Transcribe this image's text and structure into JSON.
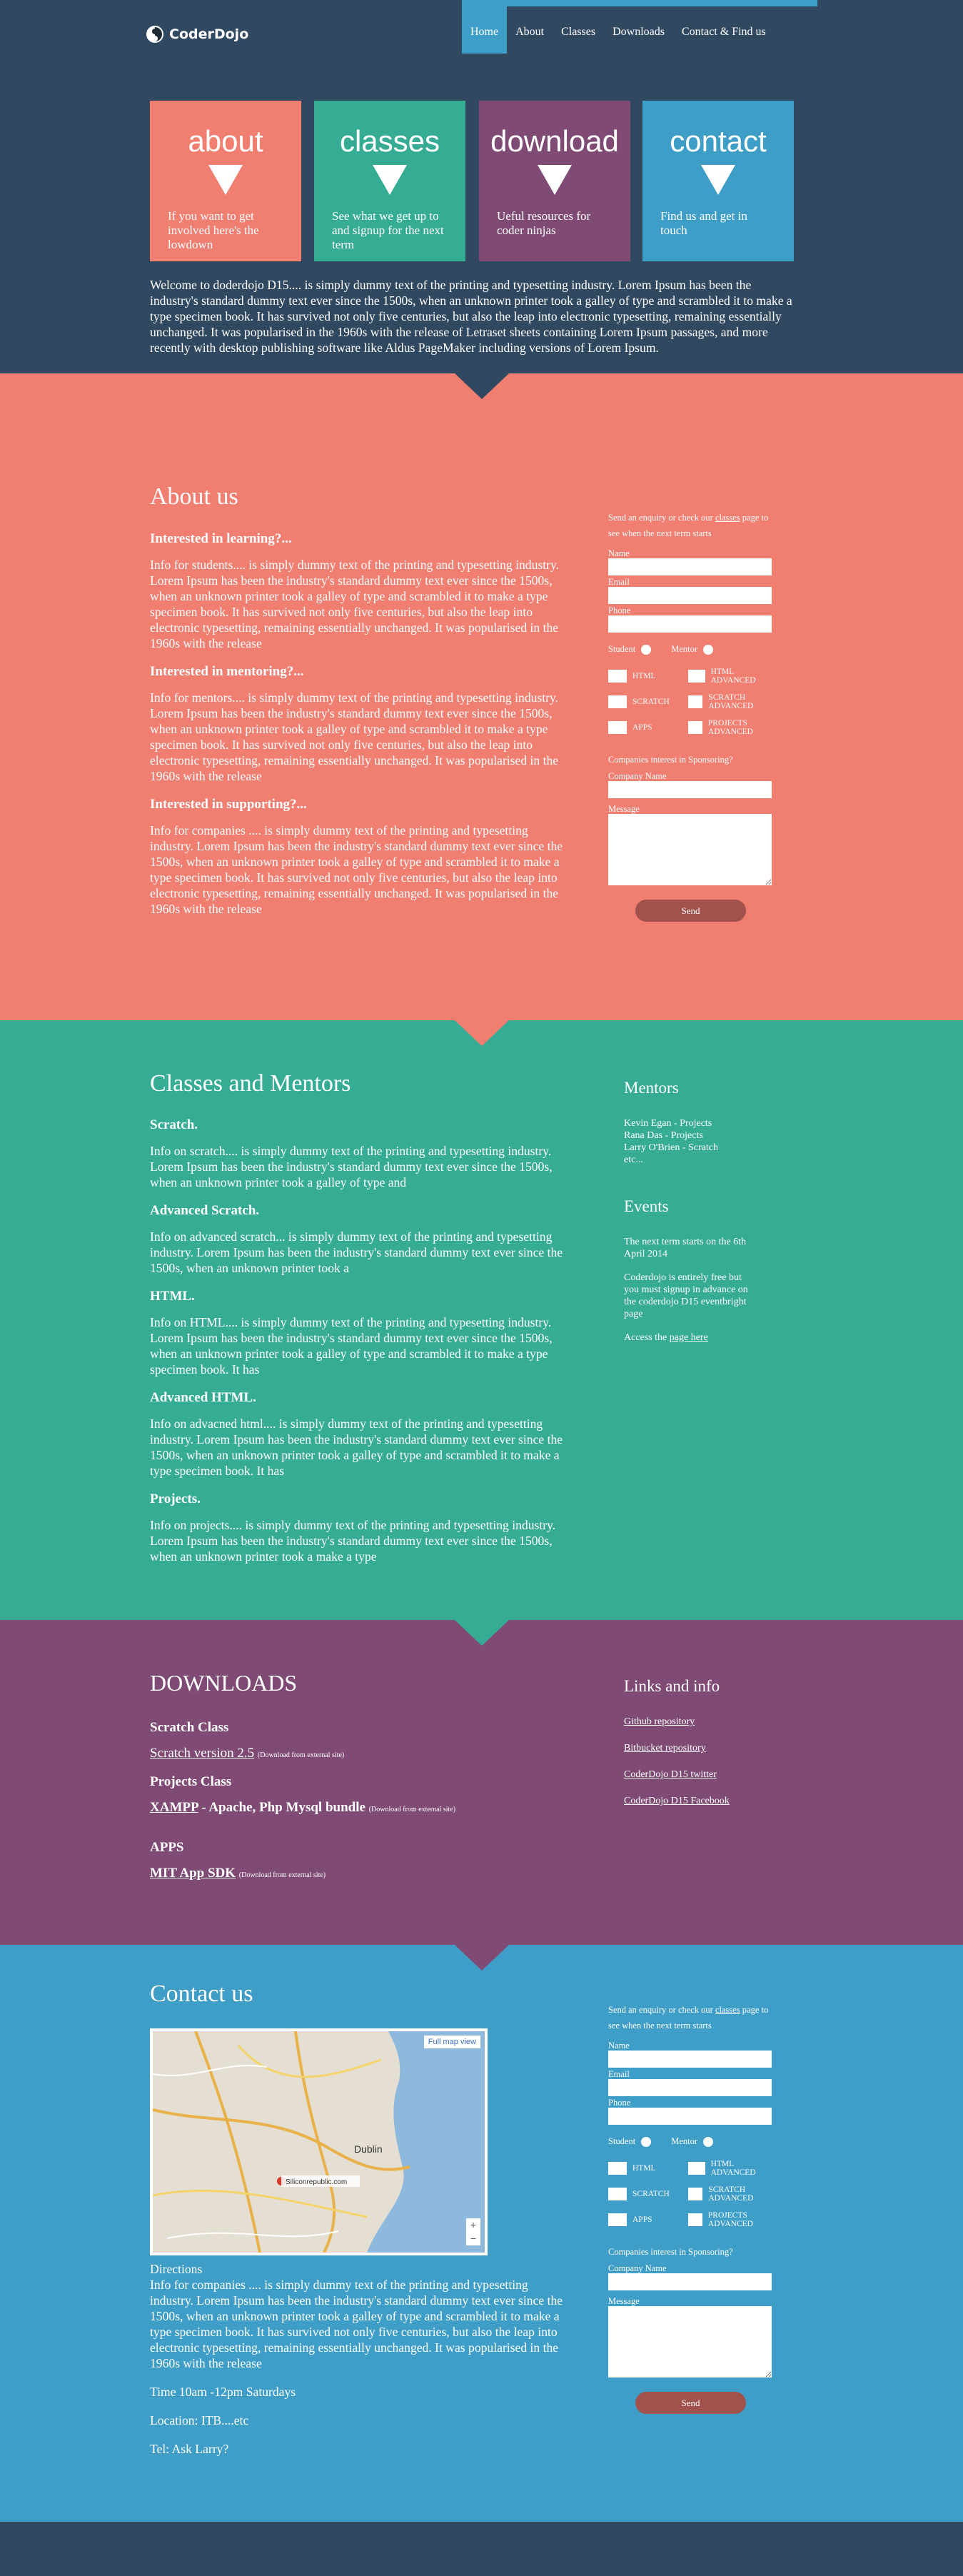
{
  "brand": {
    "name": "CoderDojo"
  },
  "nav": [
    "Home",
    "About",
    "Classes",
    "Downloads",
    "Contact & Find us"
  ],
  "tiles": [
    {
      "title": "about",
      "desc": "If you want to get involved here's the lowdown",
      "color": "#f07e71"
    },
    {
      "title": "classes",
      "desc": "See what we get up to and signup for the next term",
      "color": "#37ac94"
    },
    {
      "title": "download",
      "desc": "Ueful resources for coder ninjas",
      "color": "#7f4b74"
    },
    {
      "title": "contact",
      "desc": "Find us and get in touch",
      "color": "#3e9ec8"
    }
  ],
  "intro": "Welcome to doderdojo D15.... is simply dummy text of the printing and typesetting industry. Lorem Ipsum has been the industry's standard dummy text ever since the 1500s, when an unknown printer took a galley of type and scrambled it to make a type specimen book. It has survived not only five centuries, but also the leap into electronic typesetting, remaining essentially unchanged. It was popularised in the 1960s with the release of Letraset sheets containing Lorem Ipsum passages, and more recently with desktop publishing software like Aldus PageMaker including versions of Lorem Ipsum.",
  "about": {
    "title": "About us",
    "blocks": [
      {
        "h": "Interested in learning?...",
        "p": "Info for students.... is simply dummy text of the printing and typesetting industry. Lorem Ipsum has been the industry's standard dummy text ever since the 1500s, when an unknown printer took a galley of type and scrambled it to make a type specimen book. It has survived not only five centuries, but also the leap into electronic typesetting, remaining essentially unchanged. It was popularised in the 1960s with the release"
      },
      {
        "h": "Interested in mentoring?...",
        "p": "Info for mentors.... is simply dummy text of the printing and typesetting industry. Lorem Ipsum has been the industry's standard dummy text ever since the 1500s, when an unknown printer took a galley of type and scrambled it to make a type specimen book. It has survived not only five centuries, but also the leap into electronic typesetting, remaining essentially unchanged. It was popularised in the 1960s with the release"
      },
      {
        "h": "Interested in supporting?...",
        "p": "Info for companies .... is simply dummy text of the printing and typesetting industry. Lorem Ipsum has been the industry's standard dummy text ever since the 1500s, when an unknown printer took a galley of type and scrambled it to make a type specimen book. It has survived not only five centuries, but also the leap into electronic typesetting, remaining essentially unchanged. It was popularised in the 1960s with the release"
      }
    ]
  },
  "form": {
    "intro_pre": "Send an enquiry or check our ",
    "intro_link": "classes",
    "intro_post": " page to see when the next term starts",
    "name": "Name",
    "email": "Email",
    "phone": "Phone",
    "student": "Student",
    "mentor": "Mentor",
    "options": [
      "HTML",
      "HTML ADVANCED",
      "SCRATCH",
      "SCRATCH ADVANCED",
      "APPS",
      "PROJECTS ADVANCED"
    ],
    "sponsor": "Companies interest in Sponsoring?",
    "company": "Company Name",
    "message": "Message",
    "send": "Send"
  },
  "classes": {
    "title": "Classes and Mentors",
    "blocks": [
      {
        "h": "Scratch.",
        "p": "Info on scratch.... is simply dummy text of the printing and typesetting industry. Lorem Ipsum has been the industry's standard dummy text ever since the 1500s, when an unknown printer took a galley of type and"
      },
      {
        "h": "Advanced Scratch.",
        "p": "Info on advanced scratch... is simply dummy text of the printing and typesetting industry. Lorem Ipsum has been the industry's standard dummy text ever since the 1500s, when an unknown printer took a"
      },
      {
        "h": "HTML.",
        "p": "Info on HTML.... is simply dummy text of the printing and typesetting industry. Lorem Ipsum has been the industry's standard dummy text ever since the 1500s, when an unknown printer took a galley of type and scrambled it to make a type specimen book. It has"
      },
      {
        "h": "Advanced HTML.",
        "p": "Info on advacned html.... is simply dummy text of the printing and typesetting industry. Lorem Ipsum has been the industry's standard dummy text ever since the 1500s, when an unknown printer took a galley of type and scrambled it to make a type specimen book. It has"
      },
      {
        "h": "Projects.",
        "p": "Info on projects.... is simply dummy text of the printing and typesetting industry. Lorem Ipsum has been the industry's standard dummy text ever since the 1500s, when an unknown printer took a make a type"
      }
    ],
    "mentors_title": "Mentors",
    "mentors": [
      "Kevin Egan - Projects",
      "Rana Das - Projects",
      "Larry O'Brien - Scratch",
      "etc..."
    ],
    "events_title": "Events",
    "events_1": "The next term starts on the 6th April 2014",
    "events_2": "Coderdojo is entirely free but you must signup in advance on the coderdojo D15 eventbright page",
    "events_3_pre": "Access the ",
    "events_3_link": "page here"
  },
  "downloads": {
    "title": "DOWNLOADS",
    "scratch_h": "Scratch Class",
    "scratch_link": "Scratch version 2.5",
    "projects_h": "Projects Class",
    "xampp_link": "XAMPP",
    "xampp_rest": " - Apache, Php Mysql bundle",
    "apps_h": "APPS",
    "mit_link": "MIT App SDK",
    "external": "(Download from external site)",
    "links_title": "Links and info",
    "links": [
      "Github repository",
      "Bitbucket repository",
      "CoderDojo D15 twitter",
      "CoderDojo D15 Facebook"
    ]
  },
  "contact": {
    "title": "Contact us",
    "map_full": "Full map view",
    "map_city": "Dublin",
    "map_marker": "Siliconrepublic.com",
    "directions_h": "Directions",
    "directions": "Info for companies .... is simply dummy text of the printing and typesetting industry. Lorem Ipsum has been the industry's standard dummy text ever since the 1500s, when an unknown printer took a galley of type and scrambled it to make a type specimen book. It has survived not only five centuries, but also the leap into electronic typesetting, remaining essentially unchanged. It was popularised in the 1960s with the release",
    "time": "Time 10am -12pm Saturdays",
    "location": "Location: ITB....etc",
    "tel": "Tel: Ask Larry?"
  }
}
